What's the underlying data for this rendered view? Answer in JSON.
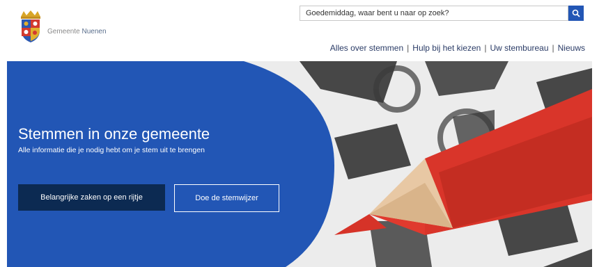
{
  "header": {
    "municipality_prefix": "Gemeente",
    "municipality_name": "Nuenen",
    "search_placeholder": "Goedemiddag, waar bent u naar op zoek?",
    "search_icon": "search-icon"
  },
  "nav": {
    "items": [
      {
        "label": "Alles over stemmen"
      },
      {
        "label": "Hulp bij het kiezen"
      },
      {
        "label": "Uw stembureau"
      },
      {
        "label": "Nieuws"
      }
    ],
    "separator": "|"
  },
  "hero": {
    "title": "Stemmen in onze gemeente",
    "subtitle": "Alle informatie die je nodig hebt om je stem uit te brengen",
    "primary_button": "Belangrijke zaken op een rijtje",
    "secondary_button": "Doe de stemwijzer"
  },
  "colors": {
    "brand_blue": "#2256b5",
    "dark_navy": "#0c2a52",
    "pencil_red": "#e03a2e"
  }
}
